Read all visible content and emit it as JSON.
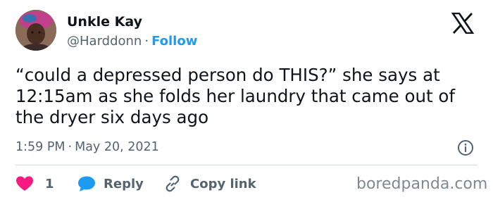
{
  "author": {
    "name": "Unkle Kay",
    "handle": "@Harddonn",
    "separator": "·",
    "follow_label": "Follow"
  },
  "tweet": {
    "text": "“could a depressed person do THIS?” she says at 12:15am as she folds her laundry that came out of the dryer six days ago"
  },
  "meta": {
    "time": "1:59 PM",
    "separator": "·",
    "date": "May 20, 2021"
  },
  "actions": {
    "like_count": "1",
    "reply_label": "Reply",
    "copy_link_label": "Copy link"
  },
  "watermark": "boredpanda.com",
  "icons": {
    "platform": "x-logo-icon",
    "like": "heart-icon",
    "reply": "speech-bubble-icon",
    "copy_link": "link-icon",
    "info": "info-icon"
  },
  "colors": {
    "accent": "#1d9bf0",
    "like": "#f91880",
    "text": "#0f1419",
    "secondary": "#536471"
  }
}
